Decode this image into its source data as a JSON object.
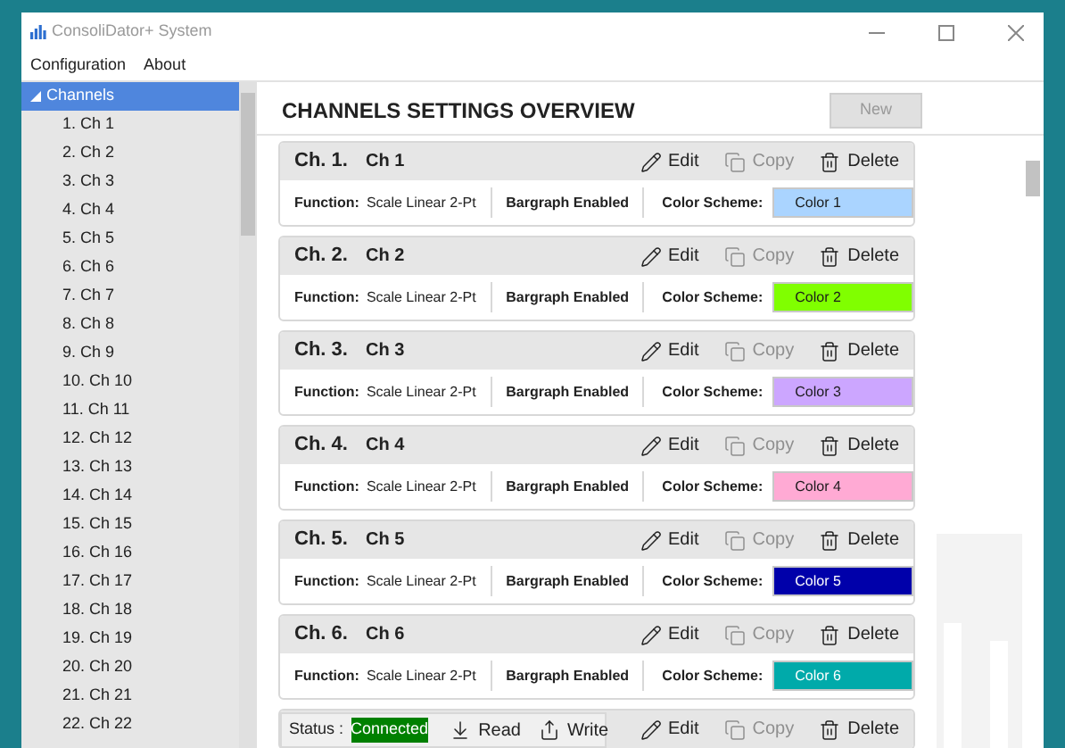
{
  "window": {
    "title": "ConsoliDator+ System"
  },
  "menu": [
    "Configuration",
    "About"
  ],
  "sidebar": {
    "root": {
      "label": "Channels",
      "expanded": true,
      "selected": true,
      "children": [
        {
          "label": "1. Ch 1"
        },
        {
          "label": "2. Ch 2"
        },
        {
          "label": "3. Ch 3"
        },
        {
          "label": "4. Ch 4"
        },
        {
          "label": "5. Ch 5"
        },
        {
          "label": "6. Ch 6"
        },
        {
          "label": "7. Ch 7"
        },
        {
          "label": "8. Ch 8"
        },
        {
          "label": "9. Ch 9"
        },
        {
          "label": "10. Ch 10"
        },
        {
          "label": "11. Ch 11"
        },
        {
          "label": "12. Ch 12"
        },
        {
          "label": "13. Ch 13"
        },
        {
          "label": "14. Ch 14"
        },
        {
          "label": "15. Ch 15"
        },
        {
          "label": "16. Ch 16"
        },
        {
          "label": "17. Ch 17"
        },
        {
          "label": "18. Ch 18"
        },
        {
          "label": "19. Ch 19"
        },
        {
          "label": "20. Ch 20"
        },
        {
          "label": "21. Ch 21"
        },
        {
          "label": "22. Ch 22"
        }
      ]
    }
  },
  "heading": "CHANNELS SETTINGS OVERVIEW",
  "new_button": {
    "label": "New",
    "disabled": true
  },
  "channels": [
    {
      "number": "Ch. 1.",
      "name": "Ch 1",
      "function_label": "Function:",
      "function": "Scale Linear 2-Pt",
      "bargraph": "Bargraph Enabled",
      "scheme_label": "Color Scheme:",
      "scheme": "Color 1",
      "color": "#aad4ff",
      "actions": [
        {
          "kind": "edit",
          "label": "Edit",
          "disabled": false
        },
        {
          "kind": "copy",
          "label": "Copy",
          "disabled": true
        },
        {
          "kind": "delete",
          "label": "Delete",
          "disabled": false
        }
      ]
    },
    {
      "number": "Ch. 2.",
      "name": "Ch 2",
      "function_label": "Function:",
      "function": "Scale Linear 2-Pt",
      "bargraph": "Bargraph Enabled",
      "scheme_label": "Color Scheme:",
      "scheme": "Color 2",
      "color": "#80ff00",
      "actions": [
        {
          "kind": "edit",
          "label": "Edit",
          "disabled": false
        },
        {
          "kind": "copy",
          "label": "Copy",
          "disabled": true
        },
        {
          "kind": "delete",
          "label": "Delete",
          "disabled": false
        }
      ]
    },
    {
      "number": "Ch. 3.",
      "name": "Ch 3",
      "function_label": "Function:",
      "function": "Scale Linear 2-Pt",
      "bargraph": "Bargraph Enabled",
      "scheme_label": "Color Scheme:",
      "scheme": "Color 3",
      "color": "#cca6ff",
      "actions": [
        {
          "kind": "edit",
          "label": "Edit",
          "disabled": false
        },
        {
          "kind": "copy",
          "label": "Copy",
          "disabled": true
        },
        {
          "kind": "delete",
          "label": "Delete",
          "disabled": false
        }
      ]
    },
    {
      "number": "Ch. 4.",
      "name": "Ch 4",
      "function_label": "Function:",
      "function": "Scale Linear 2-Pt",
      "bargraph": "Bargraph Enabled",
      "scheme_label": "Color Scheme:",
      "scheme": "Color 4",
      "color": "#ffaad4",
      "actions": [
        {
          "kind": "edit",
          "label": "Edit",
          "disabled": false
        },
        {
          "kind": "copy",
          "label": "Copy",
          "disabled": true
        },
        {
          "kind": "delete",
          "label": "Delete",
          "disabled": false
        }
      ]
    },
    {
      "number": "Ch. 5.",
      "name": "Ch 5",
      "function_label": "Function:",
      "function": "Scale Linear 2-Pt",
      "bargraph": "Bargraph Enabled",
      "scheme_label": "Color Scheme:",
      "scheme": "Color 5",
      "color": "#0000aa",
      "actions": [
        {
          "kind": "edit",
          "label": "Edit",
          "disabled": false
        },
        {
          "kind": "copy",
          "label": "Copy",
          "disabled": true
        },
        {
          "kind": "delete",
          "label": "Delete",
          "disabled": false
        }
      ]
    },
    {
      "number": "Ch. 6.",
      "name": "Ch 6",
      "function_label": "Function:",
      "function": "Scale Linear 2-Pt",
      "bargraph": "Bargraph Enabled",
      "scheme_label": "Color Scheme:",
      "scheme": "Color 6",
      "color": "#00aaaa",
      "actions": [
        {
          "kind": "edit",
          "label": "Edit",
          "disabled": false
        },
        {
          "kind": "copy",
          "label": "Copy",
          "disabled": true
        },
        {
          "kind": "delete",
          "label": "Delete",
          "disabled": false
        }
      ]
    },
    {
      "actions": [
        {
          "kind": "edit",
          "label": "Edit",
          "disabled": false
        },
        {
          "kind": "copy",
          "label": "Copy",
          "disabled": true
        },
        {
          "kind": "delete",
          "label": "Delete",
          "disabled": false
        }
      ]
    }
  ],
  "status_bar": {
    "label": "Status :",
    "status": "Connected",
    "color": "#008000",
    "actions": [
      {
        "kind": "read",
        "label": "Read"
      },
      {
        "kind": "write",
        "label": "Write"
      }
    ]
  }
}
